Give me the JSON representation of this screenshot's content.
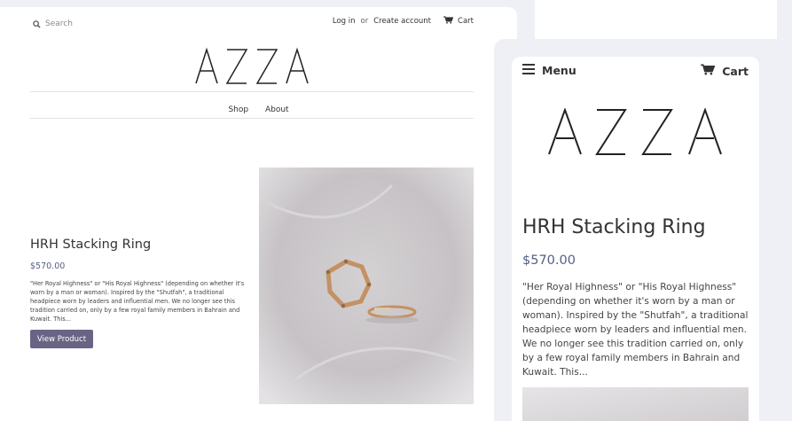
{
  "header": {
    "search_placeholder": "Search",
    "login": "Log in",
    "or": "or",
    "create_account": "Create account",
    "cart": "Cart"
  },
  "nav": {
    "items": [
      "Shop",
      "About"
    ]
  },
  "product": {
    "title": "HRH Stacking Ring",
    "price": "$570.00",
    "description": "\"Her Royal Highness\" or \"His Royal Highness\" (depending on whether it's worn by a man or woman). Inspired by the \"Shutfah\", a traditional headpiece worn by leaders and influential men. We no longer see this tradition carried on, only by a few royal family members in Bahrain and Kuwait.  This...",
    "button": "View Product"
  },
  "mobile": {
    "menu": "Menu",
    "cart": "Cart"
  },
  "colors": {
    "accent": "#6a6484",
    "price": "#555f85",
    "background": "#eef0f6"
  }
}
